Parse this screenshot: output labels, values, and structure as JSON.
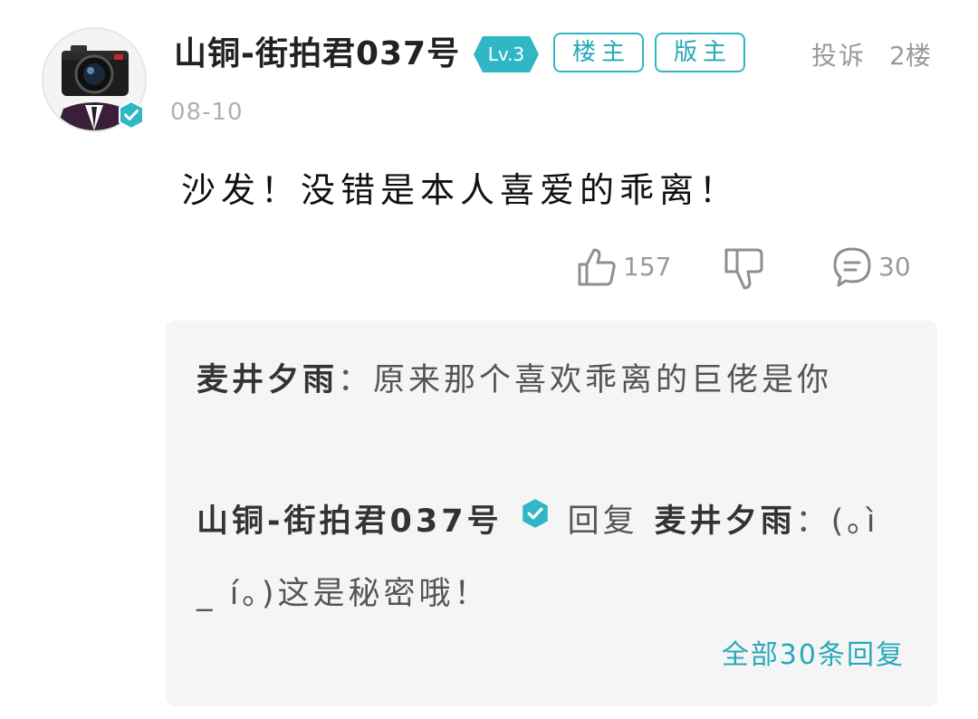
{
  "post": {
    "username": "山铜-街拍君037号",
    "level": "Lv.3",
    "tags": [
      "楼主",
      "版主"
    ],
    "report_label": "投诉",
    "floor": "2楼",
    "date": "08-10",
    "content": "沙发！没错是本人喜爱的乖离！",
    "likes": "157",
    "comments": "30"
  },
  "replies": {
    "items": [
      {
        "author": "麦井夕雨",
        "separator": "：",
        "text": "原来那个喜欢乖离的巨佬是你"
      },
      {
        "author": "山铜-街拍君037号",
        "reply_word": "回复",
        "target": "麦井夕雨",
        "separator": "：",
        "text": "(｡ì _ í｡)这是秘密哦！"
      }
    ],
    "view_all": "全部30条回复"
  },
  "colors": {
    "accent": "#2fb7c6",
    "link": "#26a9b8",
    "muted": "#9a9a9a",
    "reply_bg": "#f5f5f5"
  },
  "icons": {
    "avatar": "camera-person-avatar",
    "verified": "verified-check-icon",
    "like": "thumbs-up-icon",
    "dislike": "thumbs-down-icon",
    "comment": "comment-bubble-icon"
  }
}
